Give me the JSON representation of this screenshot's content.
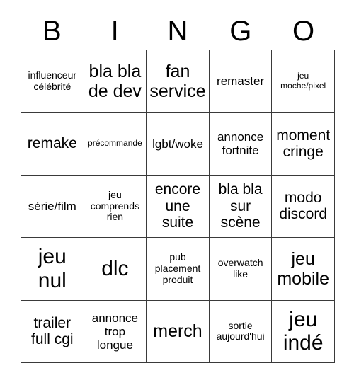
{
  "card": {
    "title": "BINGO",
    "header_letters": [
      "B",
      "I",
      "N",
      "G",
      "O"
    ],
    "columns": 5,
    "rows": 5,
    "colors": {
      "text": "#000000",
      "background": "#ffffff",
      "grid_line": "#3a3a3a"
    },
    "cells": [
      {
        "text": "influenceur\ncélébrité",
        "size": "s"
      },
      {
        "text": "bla bla\nde dev",
        "size": "xl"
      },
      {
        "text": "fan\nservice",
        "size": "xl"
      },
      {
        "text": "remaster",
        "size": "m"
      },
      {
        "text": "jeu\nmoche/pixel",
        "size": "xs"
      },
      {
        "text": "remake",
        "size": "l"
      },
      {
        "text": "précommande",
        "size": "xs"
      },
      {
        "text": "lgbt/woke",
        "size": "m"
      },
      {
        "text": "annonce\nfortnite",
        "size": "m"
      },
      {
        "text": "moment\ncringe",
        "size": "l"
      },
      {
        "text": "série/film",
        "size": "m"
      },
      {
        "text": "jeu\ncomprends\nrien",
        "size": "s"
      },
      {
        "text": "encore\nune\nsuite",
        "size": "l"
      },
      {
        "text": "bla bla\nsur\nscène",
        "size": "l"
      },
      {
        "text": "modo\ndiscord",
        "size": "l"
      },
      {
        "text": "jeu\nnul",
        "size": "xxl"
      },
      {
        "text": "dlc",
        "size": "xxl"
      },
      {
        "text": "pub\nplacement\nproduit",
        "size": "s"
      },
      {
        "text": "overwatch\nlike",
        "size": "s"
      },
      {
        "text": "jeu\nmobile",
        "size": "xl"
      },
      {
        "text": "trailer\nfull cgi",
        "size": "l"
      },
      {
        "text": "annonce\ntrop\nlongue",
        "size": "m"
      },
      {
        "text": "merch",
        "size": "xl"
      },
      {
        "text": "sortie\naujourd'hui",
        "size": "s"
      },
      {
        "text": "jeu\nindé",
        "size": "xxl"
      }
    ]
  }
}
